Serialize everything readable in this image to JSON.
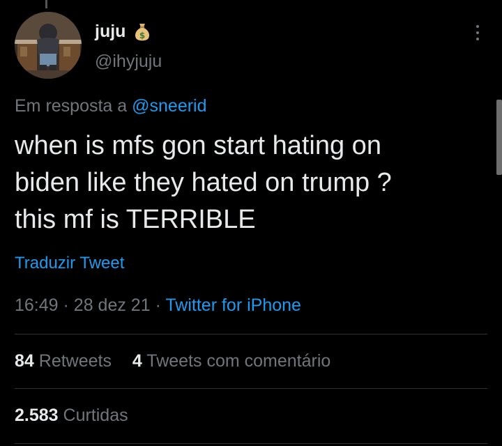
{
  "author": {
    "display_name": "juju",
    "badge_icon": "money-bag-icon",
    "handle": "@ihyjuju"
  },
  "reply": {
    "prefix": "Em resposta a",
    "mention": "@sneerid"
  },
  "tweet": {
    "text": "when is mfs gon start hating on\nbiden like they hated on trump ?\nthis mf is TERRIBLE",
    "translate_label": "Traduzir Tweet"
  },
  "meta": {
    "time": "16:49",
    "separator": "·",
    "date": "28 dez 21",
    "source": "Twitter for iPhone"
  },
  "stats": {
    "retweets_count": "84",
    "retweets_label": "Retweets",
    "quotes_count": "4",
    "quotes_label": "Tweets com comentário",
    "likes_count": "2.583",
    "likes_label": "Curtidas"
  },
  "colors": {
    "background": "#000000",
    "text_primary": "#e7e9ea",
    "text_secondary": "#71767b",
    "link_blue": "#1d9bf0",
    "divider": "#2f3336"
  }
}
